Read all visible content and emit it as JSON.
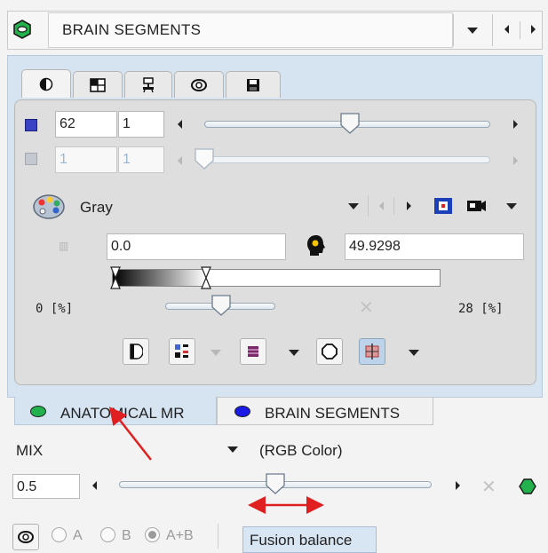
{
  "header": {
    "title": "BRAIN SEGMENTS",
    "icons": [
      "green-hexagon-icon",
      "dropdown-arrow-icon",
      "previous-arrow-icon",
      "next-arrow-icon"
    ]
  },
  "tabs": [
    {
      "icon": "contrast-icon"
    },
    {
      "icon": "layout-grid-icon"
    },
    {
      "icon": "tools-icon"
    },
    {
      "icon": "fusion-icon"
    },
    {
      "icon": "save-icon"
    }
  ],
  "slice": {
    "value": "62",
    "step": "1",
    "slider_fraction": 0.51
  },
  "frame": {
    "value": "1",
    "step": "1",
    "slider_fraction": 0.0
  },
  "colormap": {
    "name": "Gray",
    "lower": "0.0",
    "upper": "49.9298",
    "min_label": "0",
    "max_label": "28",
    "unit": "[%]"
  },
  "bottom_tabs": {
    "tab1_label": "ANATOMICAL MR",
    "tab2_label": "BRAIN SEGMENTS"
  },
  "fusion": {
    "mode": "MIX",
    "color": "(RGB Color)",
    "balance_value": "0.5",
    "balance_fraction": 0.5,
    "radio_a": "A",
    "radio_b": "B",
    "radio_ab": "A+B",
    "tooltip": "Fusion balance"
  },
  "colors": {
    "green": "#22b14c",
    "blue": "#1a1ae6",
    "arrow_red": "#e02020",
    "panel_blue": "#d6e4f2"
  }
}
